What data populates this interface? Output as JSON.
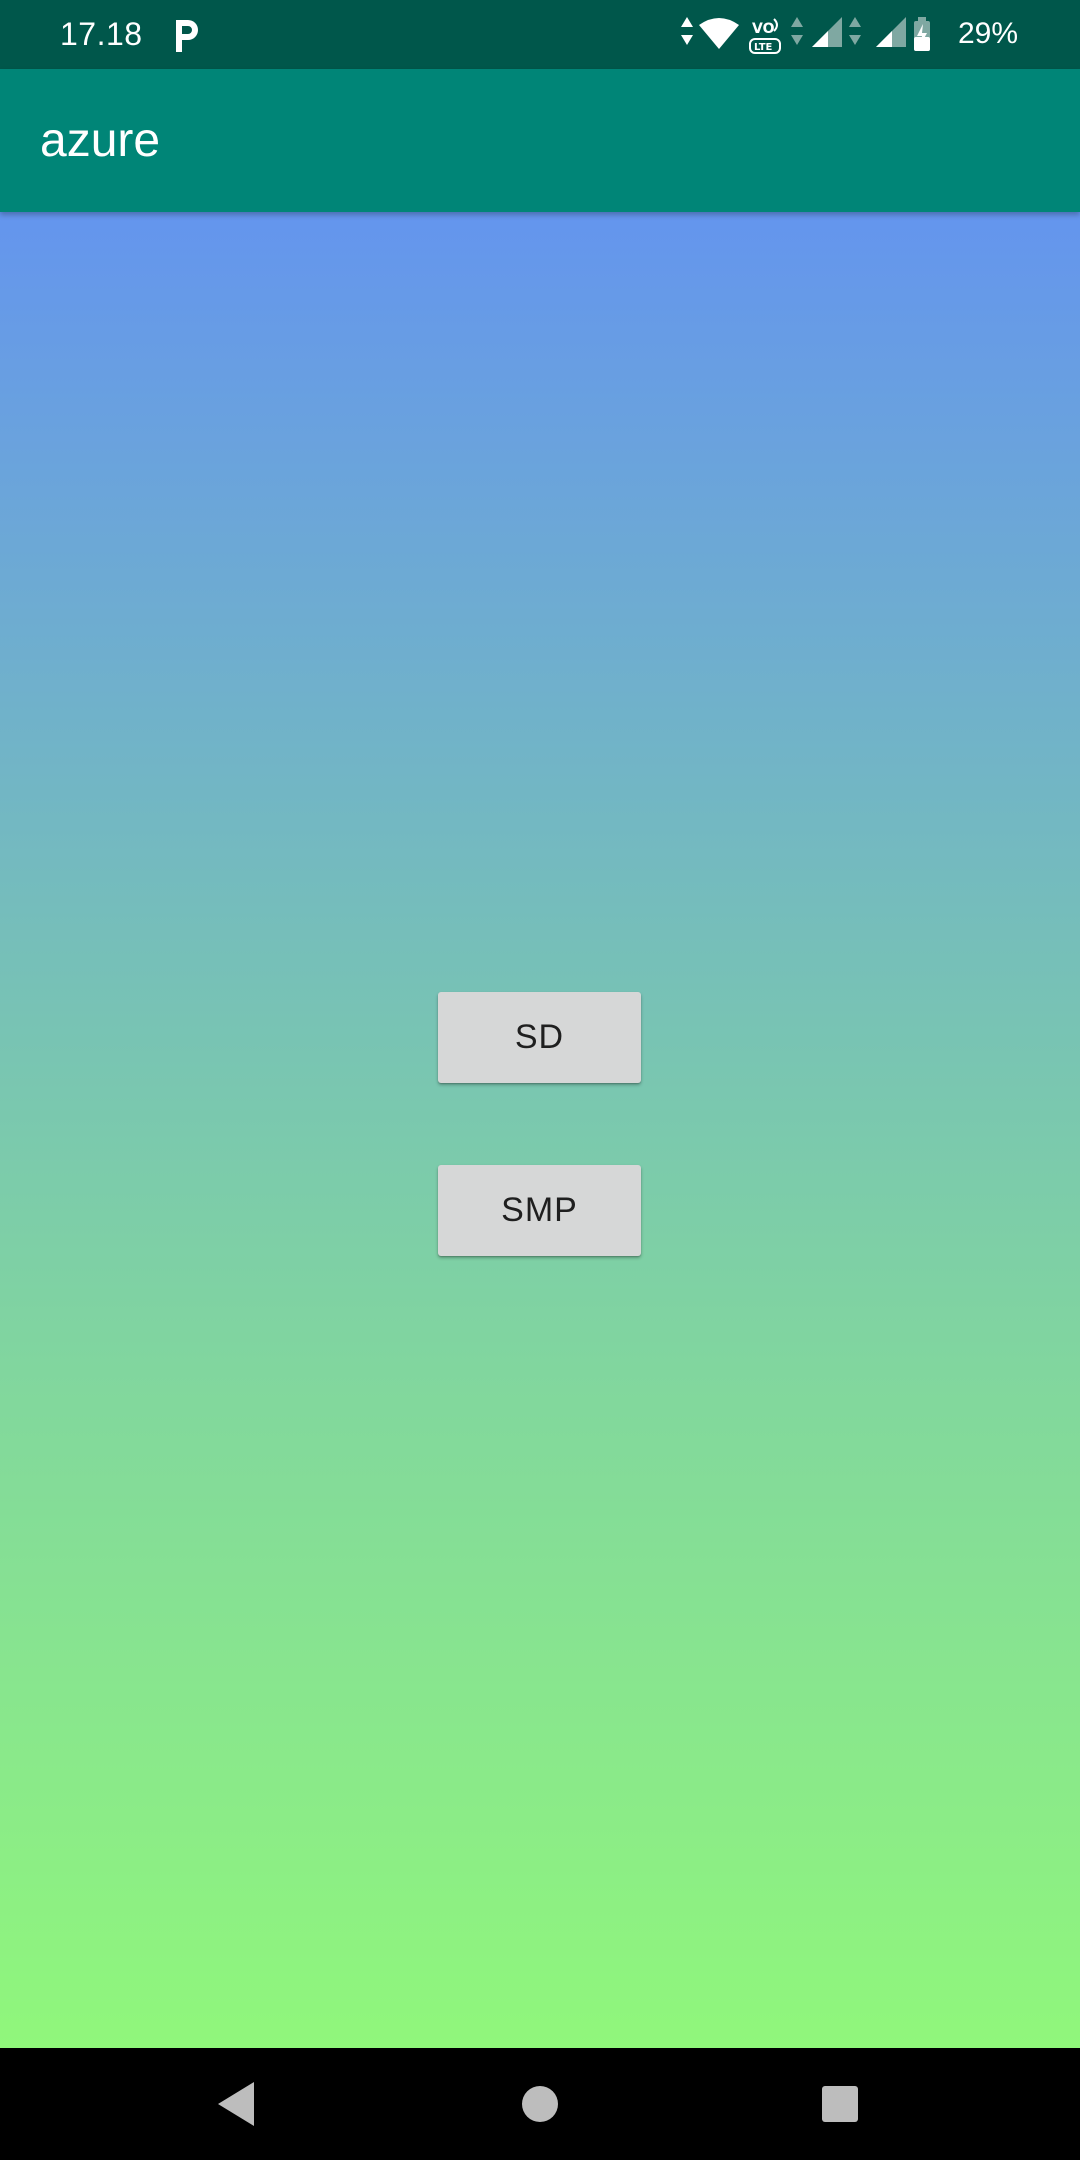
{
  "status_bar": {
    "time": "17.18",
    "battery": "29%",
    "icons": [
      "parking-icon",
      "data-arrows-icon",
      "wifi-icon",
      "volte-icon",
      "signal-1-icon",
      "signal-2-icon",
      "battery-charging-icon"
    ]
  },
  "app_bar": {
    "title": "azure"
  },
  "main": {
    "buttons": [
      {
        "label": "SD"
      },
      {
        "label": "SMP"
      }
    ]
  },
  "nav_bar": {
    "icons": [
      "back-icon",
      "home-icon",
      "recents-icon"
    ]
  },
  "colors": {
    "status_bar": "#00574b",
    "app_bar": "#008577",
    "gradient_top": "#6495ee",
    "gradient_bottom": "#90f77b",
    "button_bg": "#d6d7d7"
  }
}
